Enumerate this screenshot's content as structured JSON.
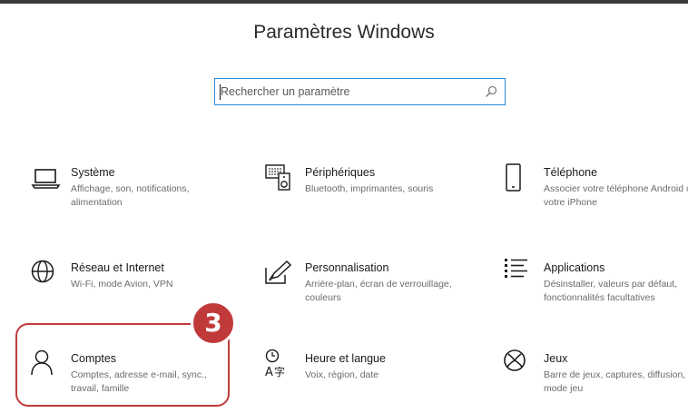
{
  "window": {
    "title": "Paramètres Windows"
  },
  "search": {
    "placeholder": "Rechercher un paramètre",
    "value": ""
  },
  "annotation": {
    "step_number": "3",
    "highlighted_item": "Comptes",
    "color": "#c03a3a"
  },
  "settings": [
    {
      "id": "systeme",
      "name": "Système",
      "description": "Affichage, son, notifications, alimentation",
      "icon": "laptop-icon"
    },
    {
      "id": "peripheriques",
      "name": "Périphériques",
      "description": "Bluetooth, imprimantes, souris",
      "icon": "devices-icon"
    },
    {
      "id": "telephone",
      "name": "Téléphone",
      "description": "Associer votre téléphone Android ou votre iPhone",
      "icon": "phone-icon"
    },
    {
      "id": "reseau",
      "name": "Réseau et Internet",
      "description": "Wi-Fi, mode Avion, VPN",
      "icon": "globe-icon"
    },
    {
      "id": "personnalisation",
      "name": "Personnalisation",
      "description": "Arrière-plan, écran de verrouillage, couleurs",
      "icon": "paintbrush-icon"
    },
    {
      "id": "applications",
      "name": "Applications",
      "description": "Désinstaller, valeurs par défaut, fonctionnalités facultatives",
      "icon": "apps-list-icon"
    },
    {
      "id": "comptes",
      "name": "Comptes",
      "description": "Comptes, adresse e-mail, sync., travail, famille",
      "icon": "person-icon"
    },
    {
      "id": "heure",
      "name": "Heure et langue",
      "description": "Voix, région, date",
      "icon": "time-language-icon"
    },
    {
      "id": "jeux",
      "name": "Jeux",
      "description": "Barre de jeux, captures, diffusion, mode jeu",
      "icon": "xbox-icon"
    }
  ]
}
